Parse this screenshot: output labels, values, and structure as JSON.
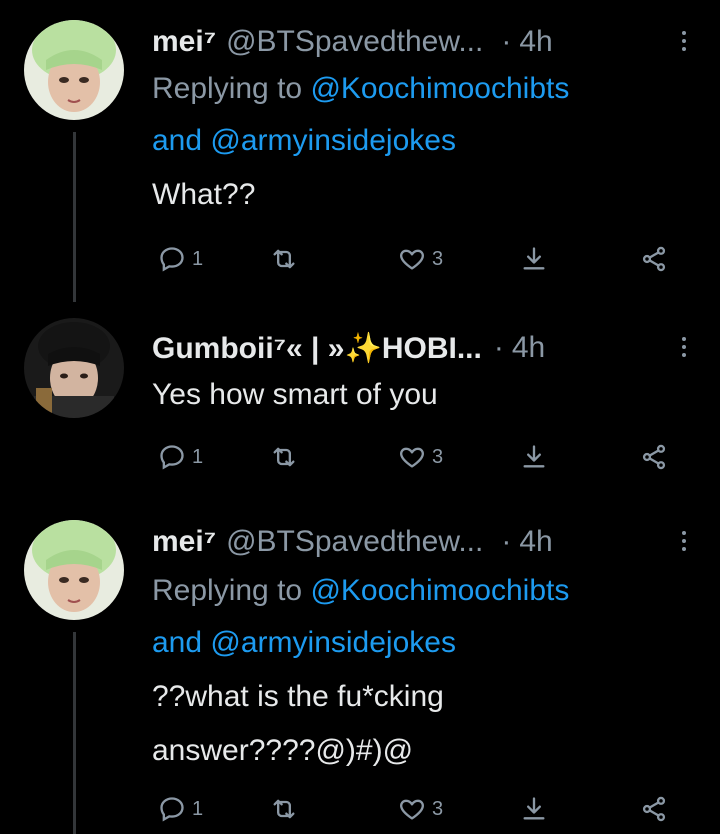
{
  "tweets": [
    {
      "name": "mei⁷",
      "handle": "@BTSpavedthew...",
      "dot": "·",
      "time": "4h",
      "reply_prefix": "Replying to",
      "reply_to_1": "@Koochimoochibts",
      "reply_and": "and",
      "reply_to_2": "@armyinsidejokes",
      "text_lines": [
        "What??"
      ],
      "reply_count": "1",
      "like_count": "3"
    },
    {
      "name": "Gumboii⁷« | »✨HOBI...",
      "dot": "·",
      "time": "4h",
      "text_lines": [
        "Yes how smart of you"
      ],
      "reply_count": "1",
      "like_count": "3"
    },
    {
      "name": "mei⁷",
      "handle": "@BTSpavedthew...",
      "dot": "·",
      "time": "4h",
      "reply_prefix": "Replying to",
      "reply_to_1": "@Koochimoochibts",
      "reply_and": "and",
      "reply_to_2": "@armyinsidejokes",
      "text_lines": [
        "??what is the fu*cking",
        "answer????@)#)@"
      ],
      "reply_count": "1",
      "like_count": "3"
    }
  ],
  "icons": [
    "reply-icon",
    "retweet-icon",
    "like-icon",
    "bookmark-icon",
    "share-icon",
    "more-icon"
  ],
  "colors": {
    "background": "#000000",
    "link": "#1d9bf0",
    "muted": "#8b98a5",
    "text": "#e7e9ea"
  }
}
